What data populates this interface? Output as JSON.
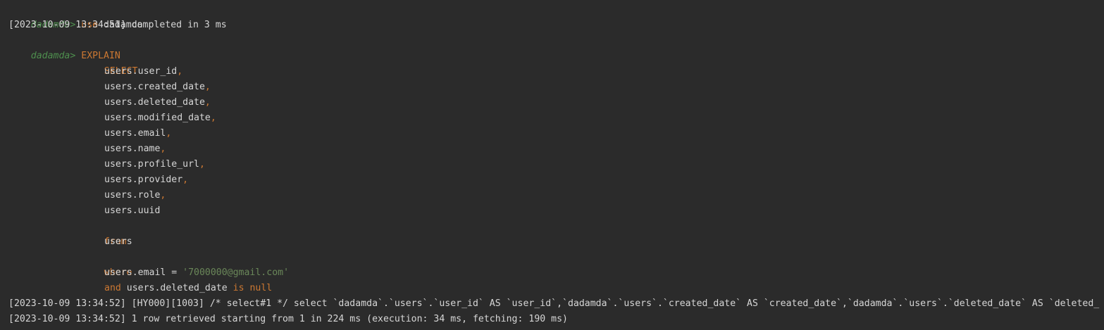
{
  "console": {
    "prompt": "dadamda>",
    "use_keyword": "use",
    "use_db": "dadamda",
    "use_result": "[2023-10-09 13:34:51] completed in 3 ms",
    "explain_keyword": "EXPLAIN",
    "select_keyword": "SELECT",
    "columns": [
      "users.user_id",
      "users.created_date",
      "users.deleted_date",
      "users.modified_date",
      "users.email",
      "users.name",
      "users.profile_url",
      "users.provider",
      "users.role",
      "users.uuid"
    ],
    "comma": ",",
    "from_keyword": "from",
    "from_table": "users",
    "where_keyword": "where",
    "where_lhs": "users.email = ",
    "where_value": "'7000000@gmail.com'",
    "and_keyword": "and",
    "and_lhs": "users.deleted_date",
    "is_null": "is null",
    "warning_line": "[2023-10-09 13:34:52] [HY000][1003] /* select#1 */ select `dadamda`.`users`.`user_id` AS `user_id`,`dadamda`.`users`.`created_date` AS `created_date`,`dadamda`.`users`.`deleted_date` AS `deleted_",
    "result_line": "[2023-10-09 13:34:52] 1 row retrieved starting from 1 in 224 ms (execution: 34 ms, fetching: 190 ms)"
  },
  "colors": {
    "background": "#2b2b2b",
    "keyword": "#cc7832",
    "string": "#6a8759",
    "prompt": "#4e8f4e",
    "text": "#d6d6d6"
  }
}
